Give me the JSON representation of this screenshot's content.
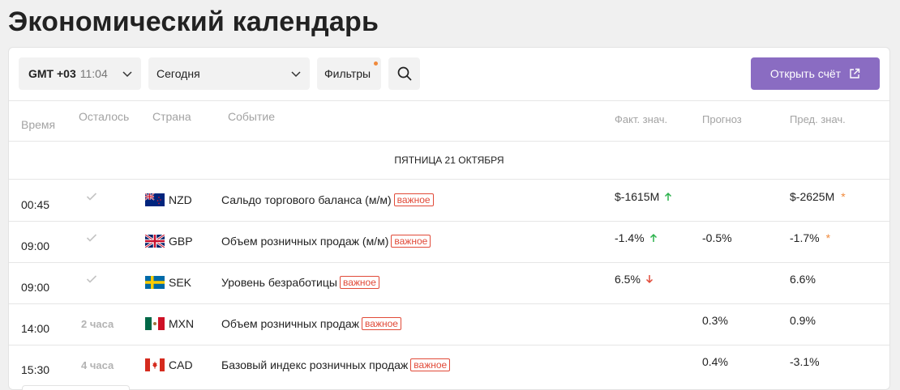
{
  "page": {
    "title": "Экономический календарь"
  },
  "toolbar": {
    "timezone_label": "GMT +03",
    "timezone_time": "11:04",
    "date_selected": "Сегодня",
    "filters_label": "Фильтры",
    "open_account_label": "Открыть счёт"
  },
  "columns": {
    "time": "Время",
    "left": "Осталось",
    "country": "Страна",
    "event": "Событие",
    "actual": "Факт. знач.",
    "forecast": "Прогноз",
    "previous": "Пред. знач."
  },
  "day_header": "ПЯТНИЦА 21 ОКТЯБРЯ",
  "events": [
    {
      "time": "00:45",
      "left": "",
      "done": true,
      "flag": "nz",
      "country": "NZD",
      "event": "Сальдо торгового баланса (м/м)",
      "badge": "важное",
      "actual": "$-1615M",
      "trend": "up",
      "forecast": "",
      "previous": "$-2625M",
      "revised": true
    },
    {
      "time": "09:00",
      "left": "",
      "done": true,
      "flag": "gb",
      "country": "GBP",
      "event": "Объем розничных продаж (м/м)",
      "badge": "важное",
      "actual": "-1.4%",
      "trend": "up",
      "forecast": "-0.5%",
      "previous": "-1.7%",
      "revised": true
    },
    {
      "time": "09:00",
      "left": "",
      "done": true,
      "flag": "se",
      "country": "SEK",
      "event": "Уровень безработицы",
      "badge": "важное",
      "actual": "6.5%",
      "trend": "down",
      "forecast": "",
      "previous": "6.6%",
      "revised": false
    },
    {
      "time": "14:00",
      "left": "2 часа",
      "done": false,
      "flag": "mx",
      "country": "MXN",
      "event": "Объем розничных продаж",
      "badge": "важное",
      "actual": "",
      "trend": "",
      "forecast": "0.3%",
      "previous": "0.9%",
      "revised": false
    },
    {
      "time": "15:30",
      "left": "4 часа",
      "done": false,
      "flag": "ca",
      "country": "CAD",
      "event": "Базовый индекс розничных продаж",
      "badge": "важное",
      "actual": "",
      "trend": "",
      "forecast": "0.4%",
      "previous": "-3.1%",
      "revised": false
    }
  ],
  "colors": {
    "accent": "#8a6cc2",
    "badge": "#e14a38",
    "up": "#2bb24c",
    "down": "#e14a38",
    "revised": "#f08a3c"
  },
  "icons": {
    "search": "search-icon",
    "external": "external-link-icon",
    "chevron": "chevron-down-icon",
    "check": "check-icon"
  }
}
